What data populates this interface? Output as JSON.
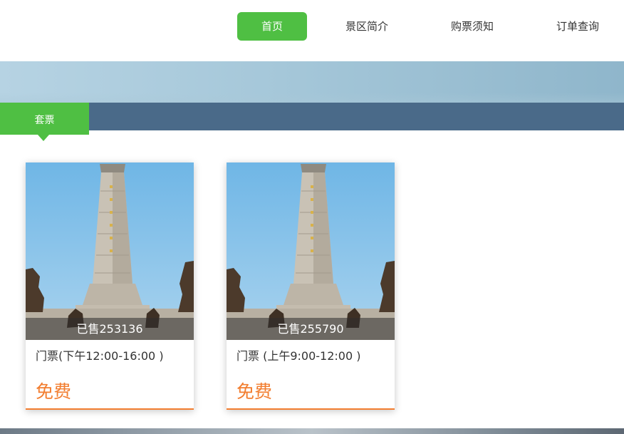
{
  "nav": {
    "items": [
      {
        "label": "首页",
        "active": true
      },
      {
        "label": "景区简介",
        "active": false
      },
      {
        "label": "购票须知",
        "active": false
      },
      {
        "label": "订单查询",
        "active": false
      }
    ],
    "active_color": "#4fbf43"
  },
  "tabs": {
    "active_label": "套票",
    "bar_color": "#4a6a89"
  },
  "products": [
    {
      "image_icon": "monument-photo",
      "sold_label": "已售253136",
      "title": "门票(下午12:00-16:00 )",
      "price": "免费"
    },
    {
      "image_icon": "monument-photo",
      "sold_label": "已售255790",
      "title": "门票 (上午9:00-12:00 )",
      "price": "免费"
    }
  ],
  "colors": {
    "accent_orange": "#f27d2f",
    "accent_green": "#4fbf43"
  }
}
